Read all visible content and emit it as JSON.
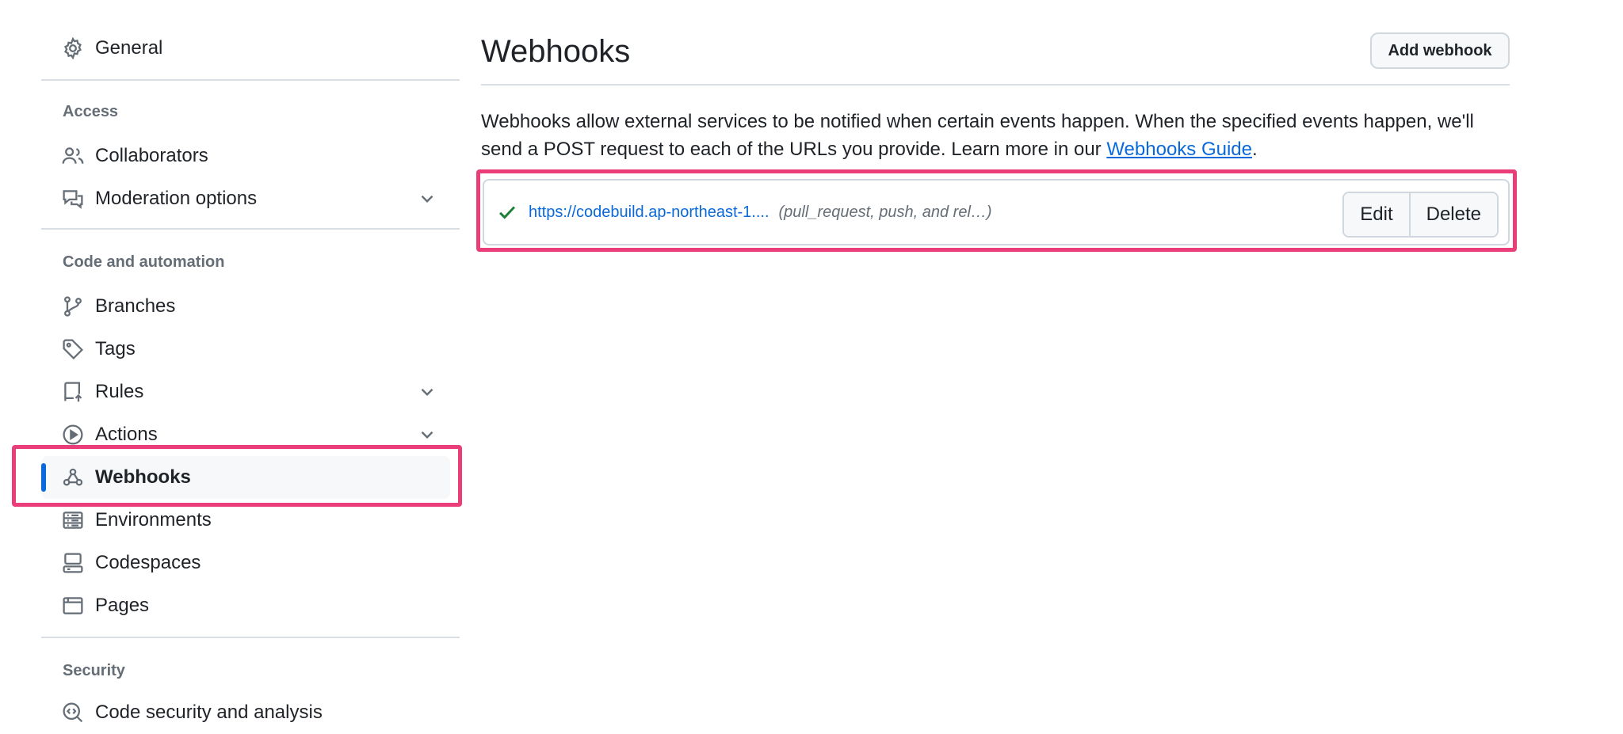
{
  "sidebar": {
    "general": "General",
    "sections": {
      "access": "Access",
      "code": "Code and automation",
      "security": "Security"
    },
    "items": {
      "collaborators": "Collaborators",
      "moderation": "Moderation options",
      "branches": "Branches",
      "tags": "Tags",
      "rules": "Rules",
      "actions": "Actions",
      "webhooks": "Webhooks",
      "environments": "Environments",
      "codespaces": "Codespaces",
      "pages": "Pages",
      "code_security": "Code security and analysis"
    }
  },
  "main": {
    "title": "Webhooks",
    "add_button": "Add webhook",
    "description_prefix": "Webhooks allow external services to be notified when certain events happen. When the specified events happen, we'll send a POST request to each of the URLs you provide. Learn more in our ",
    "guide_link": "Webhooks Guide",
    "description_suffix": ".",
    "webhook": {
      "url": "https://codebuild.ap-northeast-1....",
      "events": "(pull_request, push, and rel…)",
      "edit_label": "Edit",
      "delete_label": "Delete",
      "status_icon": "check-icon"
    }
  },
  "colors": {
    "accent": "#0969da",
    "highlight": "#ea3e7a",
    "success": "#1a7f37"
  }
}
